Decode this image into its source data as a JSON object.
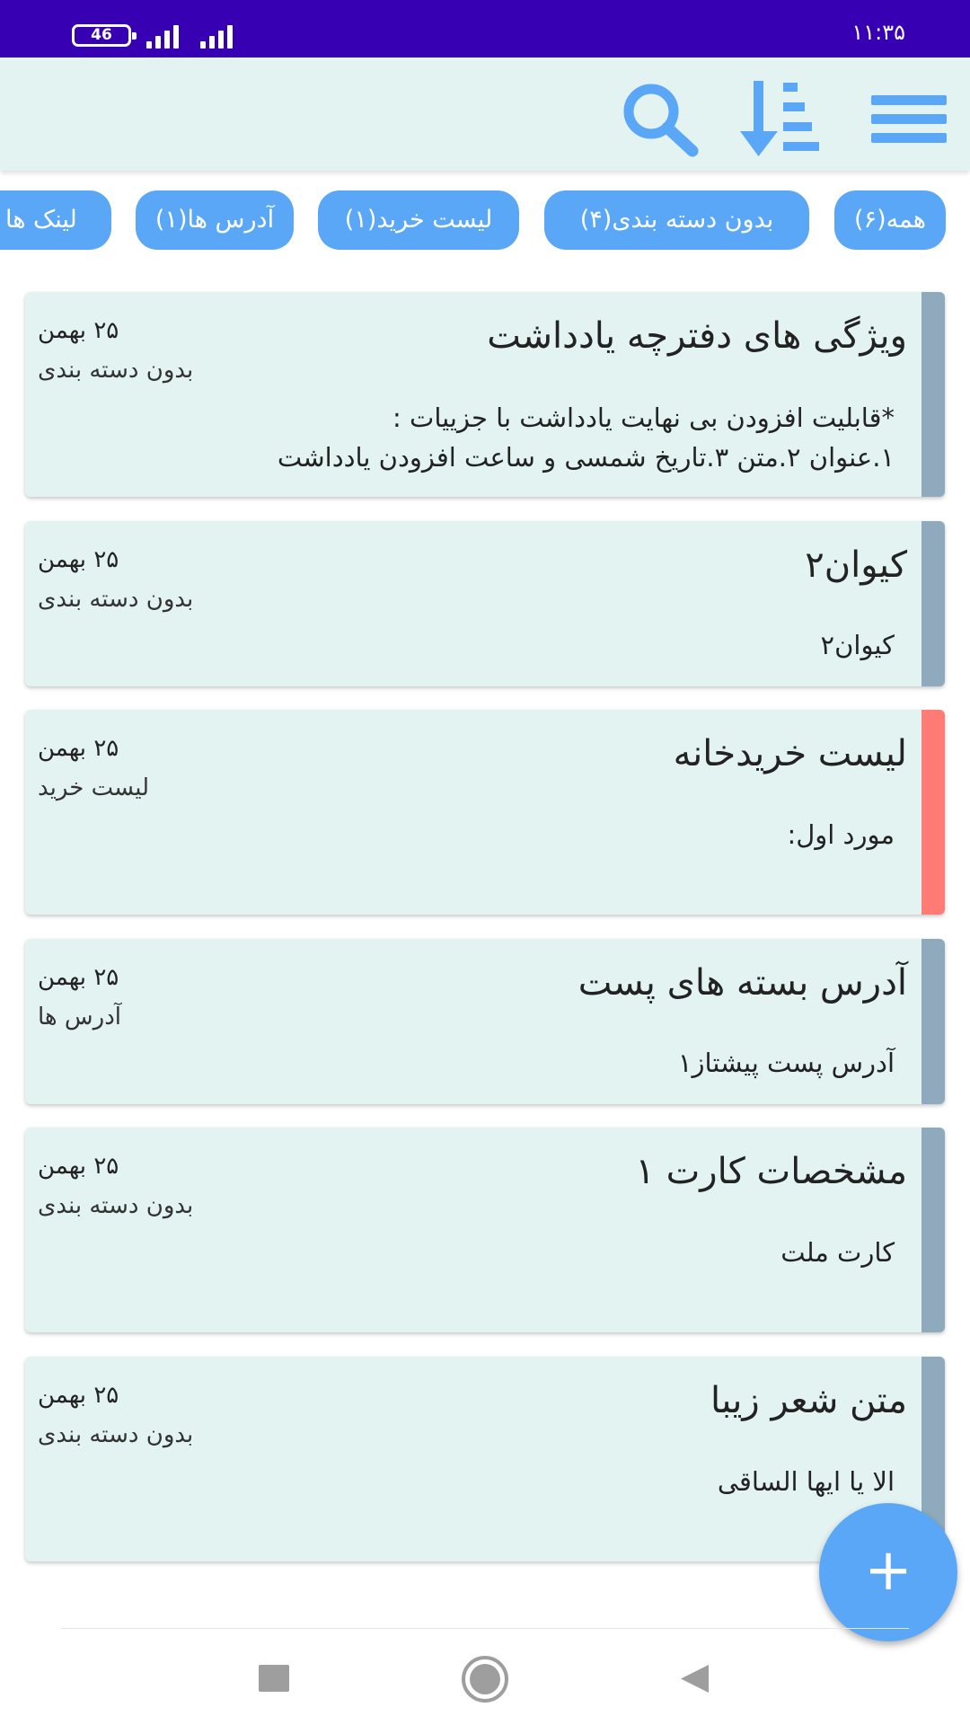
{
  "status_bar": {
    "time": "۱۱:۳۵",
    "battery": "46"
  },
  "toolbar": {
    "menu_icon": "hamburger-menu-icon",
    "sort_icon": "sort-descending-icon",
    "search_icon": "search-icon"
  },
  "filters": [
    {
      "label": "همه(۶)"
    },
    {
      "label": "بدون دسته بندی(۴)"
    },
    {
      "label": "لیست خرید(۱)"
    },
    {
      "label": "آدرس ها(۱)"
    },
    {
      "label": "لینک ها"
    }
  ],
  "notes": [
    {
      "title": "ویژگی های دفترچه یادداشت",
      "date": "۲۵ بهمن",
      "category": "بدون دسته بندی",
      "body_lines": [
        "*قابلیت افزودن بی نهایت یادداشت با جزییات :",
        "۱.عنوان ۲.متن ۳.تاریخ شمسی و ساعت افزودن یادداشت"
      ],
      "color": "#8faabd"
    },
    {
      "title": "کیوان۲",
      "date": "۲۵ بهمن",
      "category": "بدون دسته بندی",
      "body_lines": [
        "کیوان۲"
      ],
      "color": "#8faabd"
    },
    {
      "title": "لیست خریدخانه",
      "date": "۲۵ بهمن",
      "category": "لیست خرید",
      "body_lines": [
        "مورد اول:"
      ],
      "color": "#ff7b76"
    },
    {
      "title": "آدرس بسته های پست",
      "date": "۲۵ بهمن",
      "category": "آدرس ها",
      "body_lines": [
        "آدرس پست پیشتاز۱"
      ],
      "color": "#8faabd"
    },
    {
      "title": "مشخصات کارت ۱",
      "date": "۲۵ بهمن",
      "category": "بدون دسته بندی",
      "body_lines": [
        "کارت ملت"
      ],
      "color": "#8faabd"
    },
    {
      "title": "متن شعر زیبا",
      "date": "۲۵ بهمن",
      "category": "بدون دسته بندی",
      "body_lines": [
        "الا یا ایها الساقی"
      ],
      "color": "#8faabd"
    }
  ],
  "fab": {
    "label": "+",
    "icon": "add-icon"
  },
  "nav": {
    "recents_icon": "square-recents-icon",
    "home_icon": "circle-home-icon",
    "back_icon": "triangle-back-icon"
  },
  "colors": {
    "status_bar": "#3700b3",
    "toolbar_bg": "#e3f3f1",
    "accent": "#5aa7f7",
    "card_bg": "#e3f3f1"
  }
}
